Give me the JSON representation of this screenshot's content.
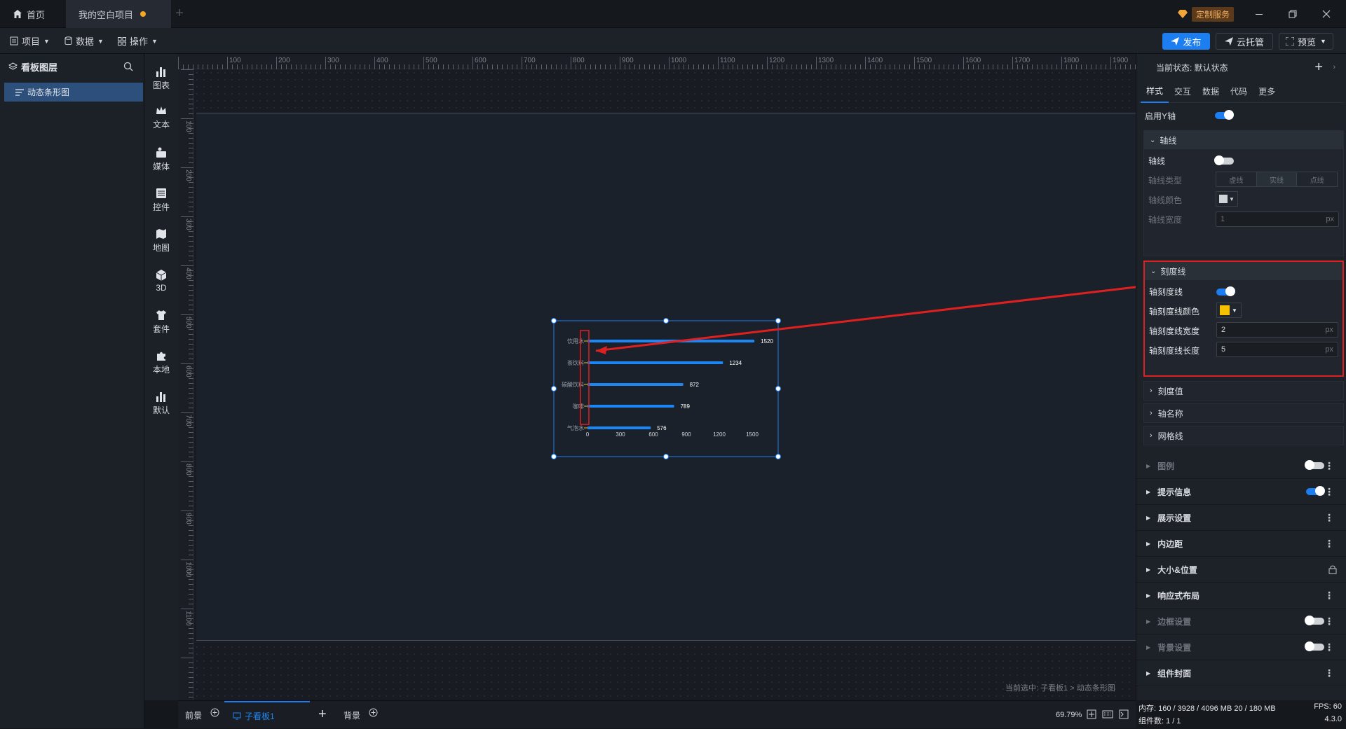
{
  "titlebar": {
    "home_label": "首页",
    "project_tab": "我的空白项目",
    "custom_service": "定制服务",
    "new_tab_plus": "+"
  },
  "toolbar": {
    "menu_project": "项目",
    "menu_data": "数据",
    "menu_operate": "操作",
    "publish": "发布",
    "cloud_host": "云托管",
    "preview": "预览"
  },
  "layers": {
    "title": "看板图层",
    "items": [
      {
        "label": "动态条形图"
      }
    ]
  },
  "components": {
    "items": [
      {
        "label": "图表",
        "icon": "bar-chart-icon"
      },
      {
        "label": "文本",
        "icon": "crown-icon"
      },
      {
        "label": "媒体",
        "icon": "media-icon"
      },
      {
        "label": "控件",
        "icon": "widget-icon"
      },
      {
        "label": "地图",
        "icon": "map-icon"
      },
      {
        "label": "3D",
        "icon": "cube-icon"
      },
      {
        "label": "套件",
        "icon": "shirt-icon"
      },
      {
        "label": "本地",
        "icon": "puzzle-icon"
      },
      {
        "label": "默认",
        "icon": "bar-chart-icon"
      }
    ]
  },
  "ruler": {
    "top": [
      "100",
      "200",
      "300",
      "400",
      "500",
      "600",
      "700",
      "800",
      "900",
      "1000",
      "1100",
      "1200",
      "1300",
      "1400",
      "1500",
      "1600",
      "1700",
      "1800",
      "1900"
    ],
    "left": [
      "100",
      "200",
      "300",
      "400",
      "500",
      "600",
      "700",
      "800",
      "900",
      "1000",
      "1100"
    ]
  },
  "canvas": {
    "selection_path": "当前选中: 子看板1 > 动态条形图"
  },
  "chart_data": {
    "type": "bar",
    "orientation": "horizontal",
    "categories": [
      "饮用水",
      "茶饮料",
      "碳酸饮料",
      "咖啡",
      "气泡水"
    ],
    "values": [
      1520,
      1234,
      872,
      789,
      576
    ],
    "x_ticks": [
      "0",
      "300",
      "600",
      "900",
      "1200",
      "1500"
    ],
    "xlim": [
      0,
      1500
    ],
    "bar_color": "#1c86f2",
    "label_color": "#ffffff"
  },
  "statusbar": {
    "tab_front": "前景",
    "tab_sub": "子看板1",
    "tab_add": "+",
    "tab_back": "背景",
    "zoom": "69.79%"
  },
  "right": {
    "current_state": "当前状态:  默认状态",
    "tabs": [
      "样式",
      "交互",
      "数据",
      "代码",
      "更多"
    ],
    "enable_y_axis": "启用Y轴",
    "axis_line_group": "轴线",
    "axis_line": "轴线",
    "axis_line_type": "轴线类型",
    "line_types": [
      "虚线",
      "实线",
      "点线"
    ],
    "axis_line_color": "轴线颜色",
    "axis_line_width": "轴线宽度",
    "axis_line_width_value": "1",
    "tick_group": "刻度线",
    "tick_enable": "轴刻度线",
    "tick_color": "轴刻度线颜色",
    "tick_color_value": "#f5c000",
    "tick_width": "轴刻度线宽度",
    "tick_width_value": "2",
    "tick_length": "轴刻度线长度",
    "tick_length_value": "5",
    "unit": "px",
    "collapsed_groups": [
      "刻度值",
      "轴名称",
      "网格线"
    ],
    "sections": [
      {
        "label": "图例",
        "dim": true,
        "toggle": "off"
      },
      {
        "label": "提示信息",
        "dim": false,
        "toggle": "on"
      },
      {
        "label": "展示设置",
        "dim": false,
        "toggle": ""
      },
      {
        "label": "内边距",
        "dim": false,
        "toggle": ""
      },
      {
        "label": "大小&位置",
        "dim": false,
        "toggle": "lock"
      },
      {
        "label": "响应式布局",
        "dim": false,
        "toggle": ""
      },
      {
        "label": "边框设置",
        "dim": true,
        "toggle": "off"
      },
      {
        "label": "背景设置",
        "dim": true,
        "toggle": "off"
      },
      {
        "label": "组件封面",
        "dim": false,
        "toggle": ""
      }
    ],
    "memory": "内存:  160 / 3928 / 4096 MB  20 / 180 MB",
    "fps": "FPS:  60",
    "component_count": "组件数: 1 / 1",
    "version": "4.3.0"
  },
  "colors": {
    "accent": "#1c7ef0",
    "highlight_red": "#e02020"
  }
}
